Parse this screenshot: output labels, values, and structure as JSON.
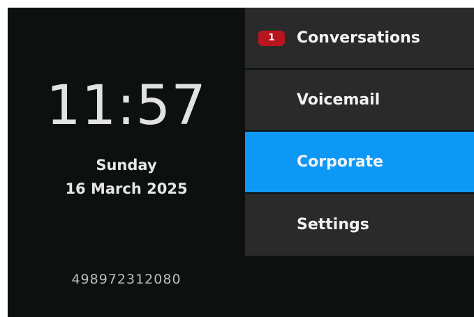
{
  "clock": {
    "time": "11:57",
    "weekday": "Sunday",
    "date": "16 March 2025"
  },
  "device": {
    "number": "498972312080"
  },
  "menu": {
    "items": [
      {
        "label": "Conversations",
        "badge": "1",
        "selected": false
      },
      {
        "label": "Voicemail",
        "selected": false
      },
      {
        "label": "Corporate",
        "selected": true
      },
      {
        "label": "Settings",
        "selected": false
      }
    ]
  },
  "colors": {
    "background": "#0c110f",
    "menu_item": "#2a2a2a",
    "selected": "#0e98f5",
    "badge": "#b8161e"
  }
}
